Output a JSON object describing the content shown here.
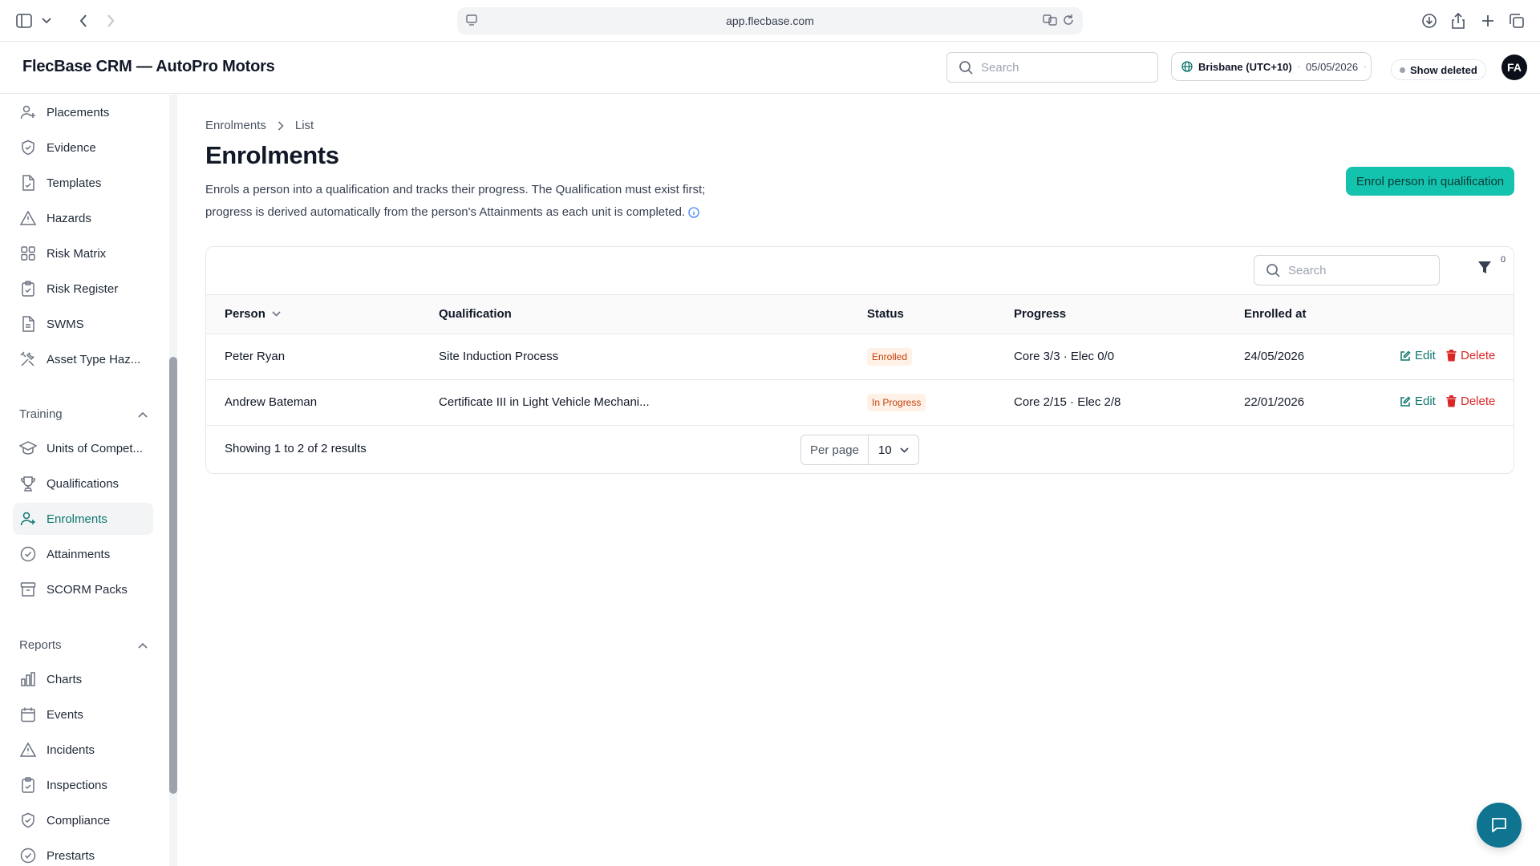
{
  "browser": {
    "url": "app.flecbase.com"
  },
  "header": {
    "app_title": "FlecBase CRM — AutoPro Motors",
    "search_placeholder": "Search",
    "timezone": "Brisbane (UTC+10)",
    "date": "05/05/2026",
    "show_deleted": "Show deleted",
    "avatar_initials": "FA"
  },
  "sidebar": {
    "items_top": [
      {
        "label": "Placements",
        "icon": "user-plus-icon"
      },
      {
        "label": "Evidence",
        "icon": "shield-check-icon"
      },
      {
        "label": "Templates",
        "icon": "file-check-icon"
      },
      {
        "label": "Hazards",
        "icon": "warning-triangle-icon"
      },
      {
        "label": "Risk Matrix",
        "icon": "grid-icon"
      },
      {
        "label": "Risk Register",
        "icon": "clipboard-check-icon"
      },
      {
        "label": "SWMS",
        "icon": "document-icon"
      },
      {
        "label": "Asset Type Haz...",
        "icon": "tools-icon"
      }
    ],
    "training_section": "Training",
    "training_items": [
      {
        "label": "Units of Compet...",
        "icon": "graduation-cap-icon"
      },
      {
        "label": "Qualifications",
        "icon": "trophy-icon"
      },
      {
        "label": "Enrolments",
        "icon": "user-plus-icon",
        "active": true
      },
      {
        "label": "Attainments",
        "icon": "check-circle-icon"
      },
      {
        "label": "SCORM Packs",
        "icon": "archive-icon"
      }
    ],
    "reports_section": "Reports",
    "reports_items": [
      {
        "label": "Charts",
        "icon": "bar-chart-icon"
      },
      {
        "label": "Events",
        "icon": "calendar-icon"
      },
      {
        "label": "Incidents",
        "icon": "warning-triangle-icon"
      },
      {
        "label": "Inspections",
        "icon": "clipboard-check-icon"
      },
      {
        "label": "Compliance",
        "icon": "shield-check-icon"
      },
      {
        "label": "Prestarts",
        "icon": "check-badge-icon"
      }
    ]
  },
  "main": {
    "breadcrumb": [
      "Enrolments",
      "List"
    ],
    "title": "Enrolments",
    "description_line1": "Enrols a person into a qualification and tracks their progress. The Qualification must exist first;",
    "description_line2": "progress is derived automatically from the person's Attainments as each unit is completed.",
    "primary_button": "Enrol person in qualification",
    "accent_color": "#14c3ad"
  },
  "table": {
    "search_placeholder": "Search",
    "filter_count": "0",
    "columns": [
      "Person",
      "Qualification",
      "Status",
      "Progress",
      "Enrolled at"
    ],
    "rows": [
      {
        "person": "Peter Ryan",
        "qualification": "Site Induction Process",
        "status": "Enrolled",
        "progress": "Core 3/3 · Elec 0/0",
        "enrolled_at": "24/05/2026",
        "edit": "Edit",
        "delete": "Delete"
      },
      {
        "person": "Andrew Bateman",
        "qualification": "Certificate III in Light Vehicle Mechani...",
        "status": "In Progress",
        "progress": "Core 2/15 · Elec 2/8",
        "enrolled_at": "22/01/2026",
        "edit": "Edit",
        "delete": "Delete"
      }
    ],
    "results_text": "Showing 1 to 2 of 2 results",
    "per_page_label": "Per page",
    "per_page_value": "10"
  }
}
